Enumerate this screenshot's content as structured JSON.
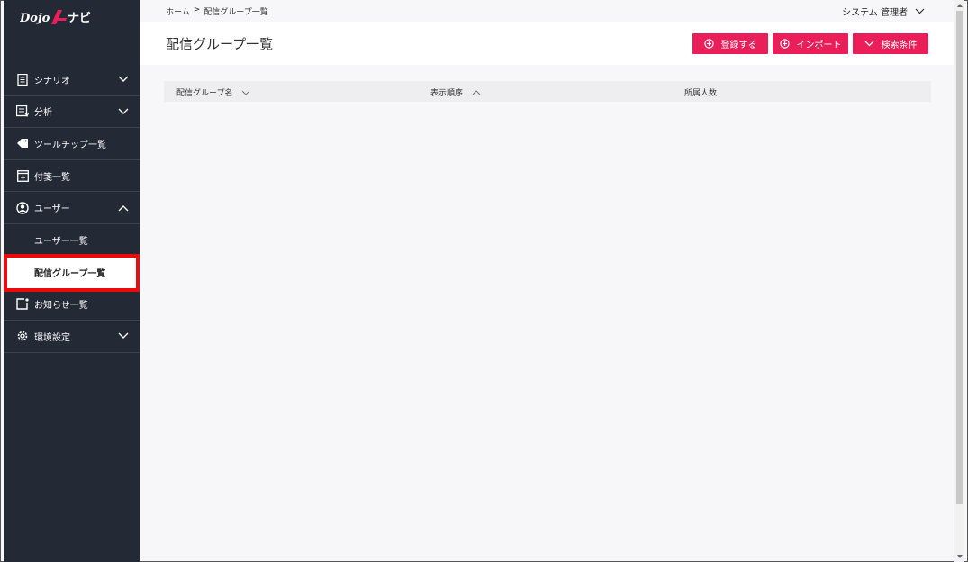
{
  "logo": {
    "text": "Dojo",
    "suffix": "ナビ"
  },
  "breadcrumb": {
    "home": "ホーム",
    "separator": ">",
    "current": "配信グループ一覧"
  },
  "user": {
    "name": "システム 管理者"
  },
  "page": {
    "title": "配信グループ一覧"
  },
  "buttons": {
    "register": "登録する",
    "import": "インポート",
    "search": "検索条件"
  },
  "sidebar": {
    "items": [
      {
        "label": "シナリオ",
        "icon": "document-icon"
      },
      {
        "label": "分析",
        "icon": "list-chart-icon"
      },
      {
        "label": "ツールチップ一覧",
        "icon": "tag-icon"
      },
      {
        "label": "付箋一覧",
        "icon": "sticky-note-icon"
      },
      {
        "label": "ユーザー",
        "icon": "user-circle-icon"
      },
      {
        "label": "ユーザー一覧"
      },
      {
        "label": "配信グループ一覧"
      },
      {
        "label": "お知らせ一覧",
        "icon": "notice-icon"
      },
      {
        "label": "環境設定",
        "icon": "gear-icon"
      }
    ]
  },
  "table": {
    "columns": [
      {
        "label": "配信グループ名",
        "sort": "desc"
      },
      {
        "label": "表示順序",
        "sort": "asc"
      },
      {
        "label": "所属人数"
      }
    ]
  },
  "colors": {
    "sidebar": "#232a36",
    "accent": "#ea1f5a",
    "highlight": "#ee0a0a"
  }
}
